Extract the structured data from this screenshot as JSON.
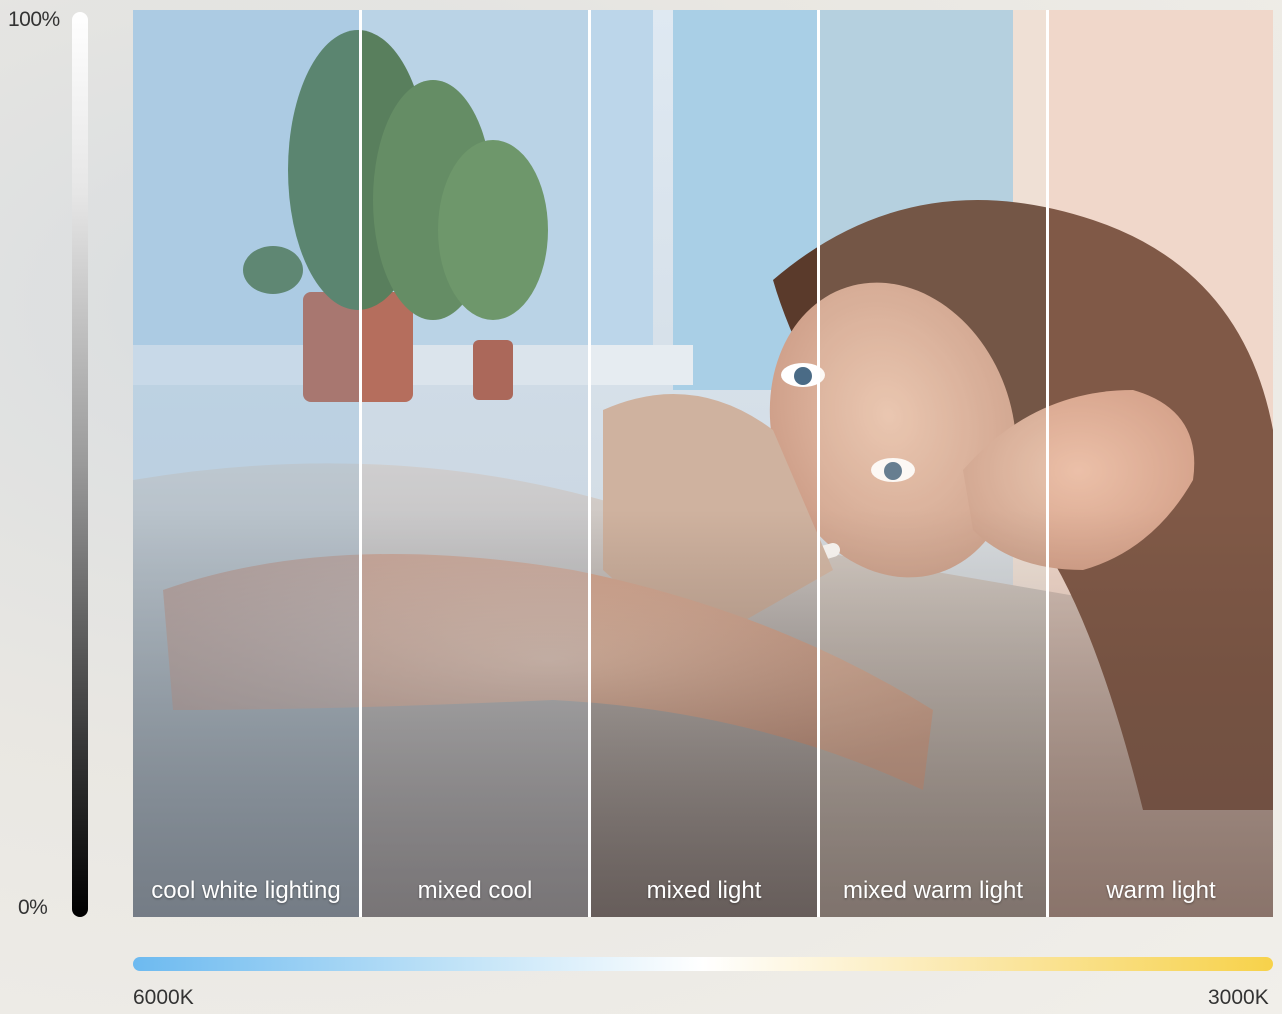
{
  "brightness_scale": {
    "max_label": "100%",
    "min_label": "0%"
  },
  "panels": [
    {
      "label": "cool white lighting",
      "tint": "#8fb7d8"
    },
    {
      "label": "mixed cool",
      "tint": "#b4c8da"
    },
    {
      "label": "mixed light",
      "tint": "#ffffff"
    },
    {
      "label": "mixed warm light",
      "tint": "#f1d6c4"
    },
    {
      "label": "warm light",
      "tint": "#f3b69a"
    }
  ],
  "color_temperature": {
    "left_label": "6000K",
    "right_label": "3000K"
  },
  "colors": {
    "cool": "#6dbaf0",
    "warm": "#f7d24a",
    "divider": "#ffffff"
  }
}
